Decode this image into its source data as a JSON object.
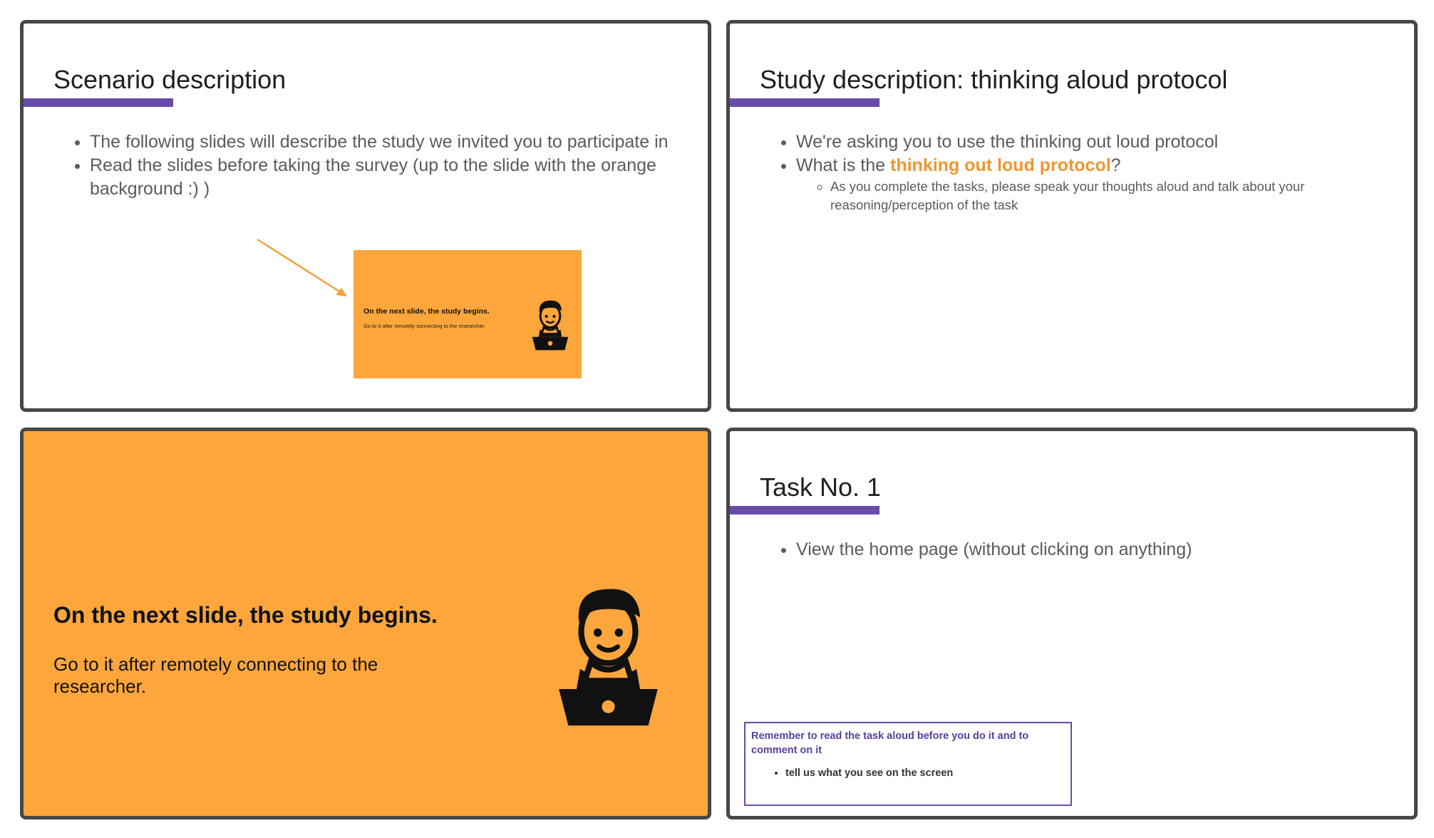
{
  "slides": {
    "scenario": {
      "title": "Scenario description",
      "bullets": [
        "The following slides will describe the study we invited you to participate in",
        "Read the slides before taking the survey (up to the slide with the orange background :) )"
      ],
      "thumbnail": {
        "title": "On the next slide, the study begins.",
        "subtitle": "Go to it after remotely connecting to the researcher."
      }
    },
    "study": {
      "title": "Study description: thinking aloud protocol",
      "bullet1": "We're asking you to use the thinking out loud protocol",
      "bullet2_prefix": "What is the ",
      "bullet2_highlight": "thinking out loud protocol",
      "bullet2_suffix": "?",
      "sub_bullet": "As you complete the tasks, please speak your thoughts aloud and talk about your reasoning/perception of the task"
    },
    "begin": {
      "title": "On the next slide, the study begins.",
      "subtitle": "Go to it after remotely connecting to the researcher."
    },
    "task": {
      "title": "Task No. 1",
      "bullet": "View the home page (without clicking on anything)",
      "reminder_title": "Remember to read the task aloud before you do it and to comment on it",
      "reminder_bullet": "tell us what you see on the screen"
    }
  },
  "icons": {
    "arrow": "arrow-icon",
    "person": "person-laptop-icon"
  },
  "colors": {
    "accent_purple": "#6a4ba8",
    "orange_background": "#fca63c",
    "highlight_orange": "#f0962f",
    "frame_border": "#474747"
  }
}
